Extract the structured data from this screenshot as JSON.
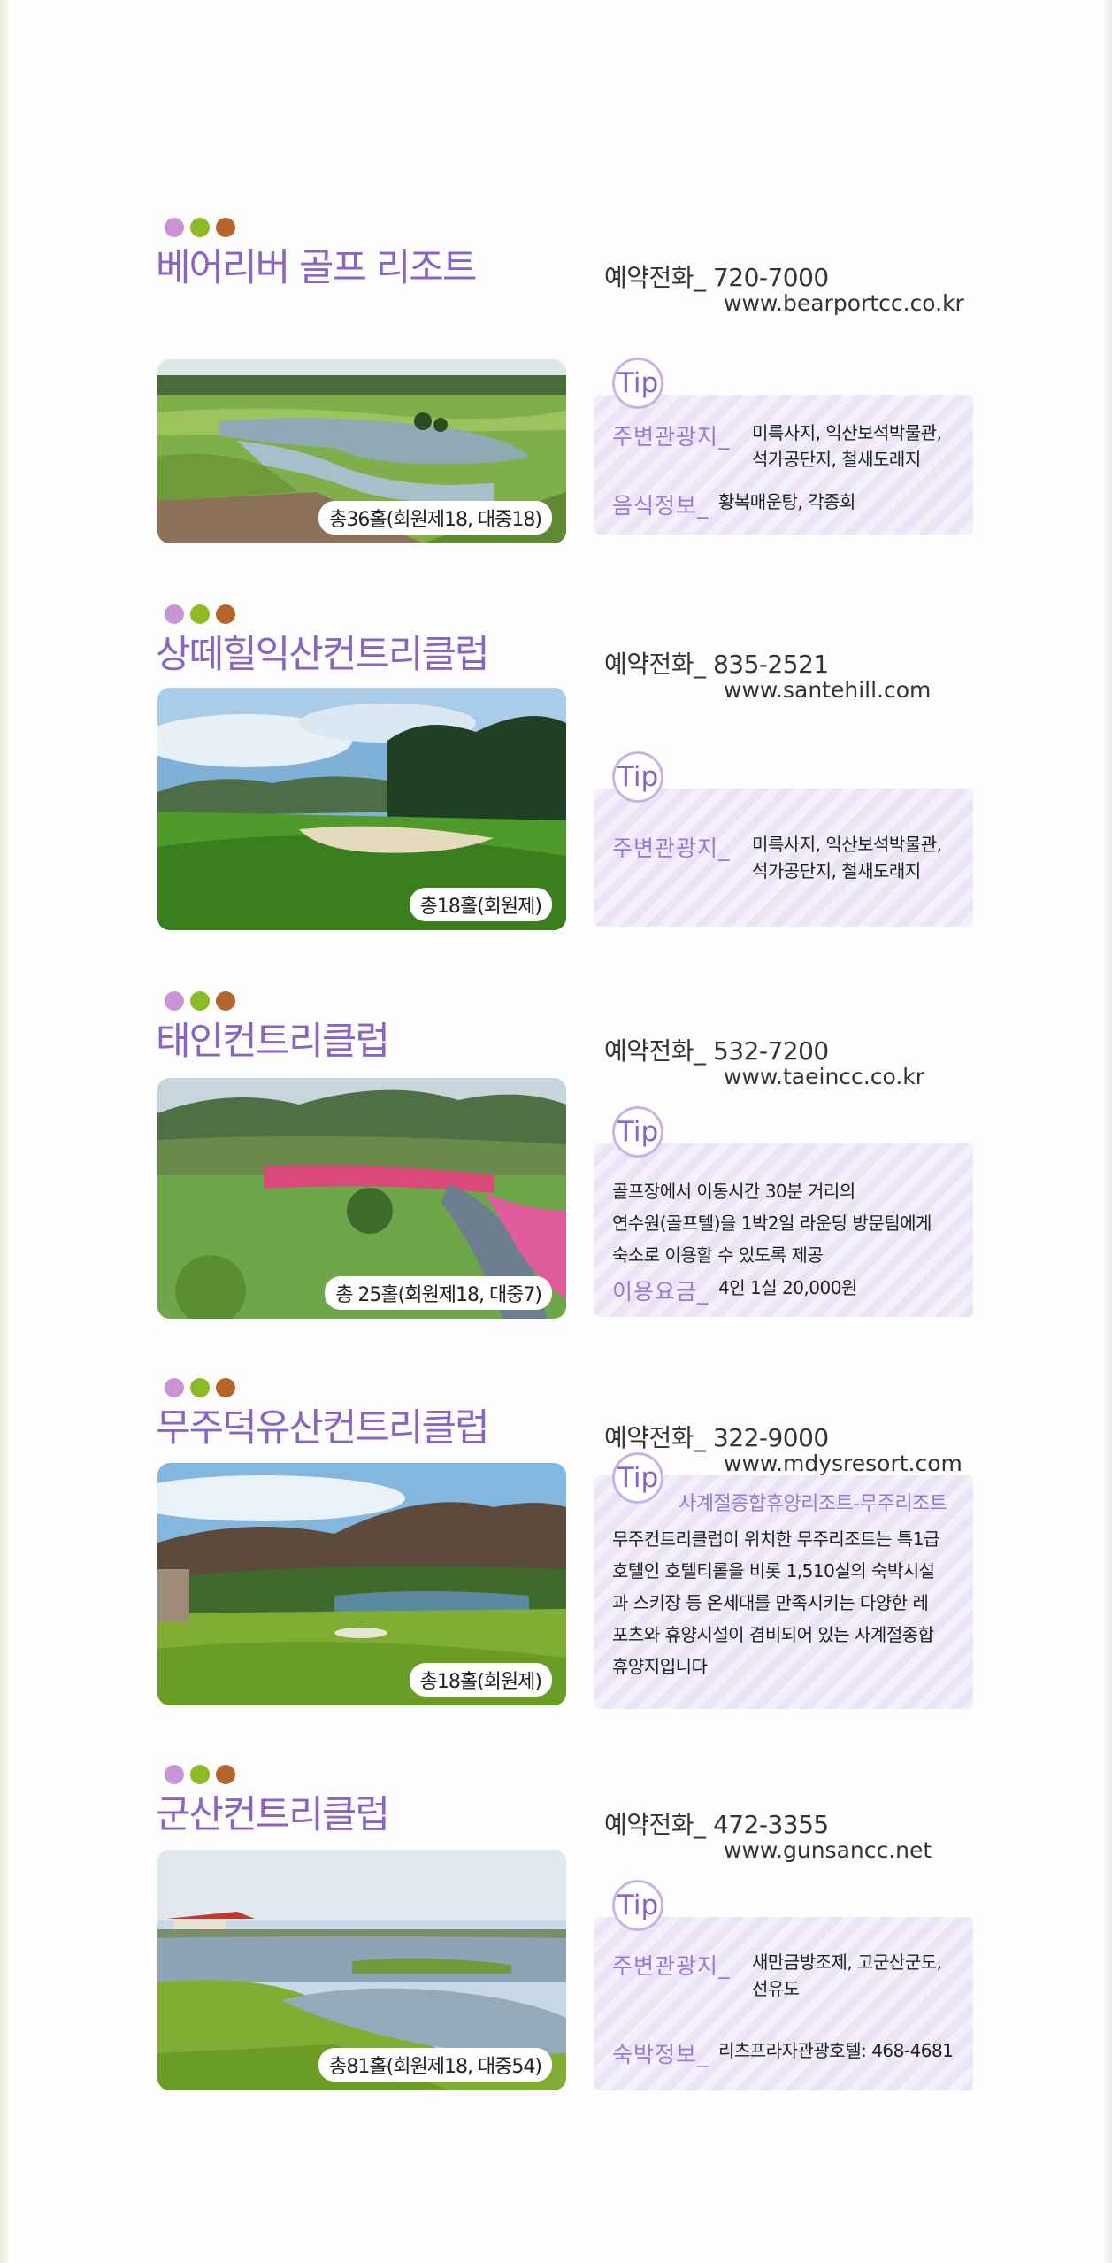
{
  "courses": [
    {
      "title": "베어리버 골프 리조트",
      "phone": "예약전화_ 720-7000",
      "website": "www.bearportcc.co.kr",
      "holes": "총36홀(회원제18, 대중18)",
      "tip_label": "Tip",
      "tip": [
        {
          "label": "주변관광지_",
          "value": "미륵사지, 익산보석박물관,\n석가공단지, 철새도래지"
        },
        {
          "label": "음식정보_",
          "value": "황복매운탕, 각종회"
        }
      ]
    },
    {
      "title": "상떼힐익산컨트리클럽",
      "phone": "예약전화_ 835-2521",
      "website": "www.santehill.com",
      "holes": "총18홀(회원제)",
      "tip_label": "Tip",
      "tip": [
        {
          "label": "주변관광지_",
          "value": "미륵사지, 익산보석박물관,\n석가공단지, 철새도래지"
        }
      ]
    },
    {
      "title": "태인컨트리클럽",
      "phone": "예약전화_ 532-7200",
      "website": "www.taeincc.co.kr",
      "holes": "총 25홀(회원제18, 대중7)",
      "tip_label": "Tip",
      "tip_text": "골프장에서 이동시간 30분 거리의\n연수원(골프텔)을 1박2일 라운딩 방문팀에게\n숙소로 이용할 수 있도록 제공",
      "tip": [
        {
          "label": "이용요금_",
          "value": "4인 1실 20,000원"
        }
      ]
    },
    {
      "title": "무주덕유산컨트리클럽",
      "phone": "예약전화_ 322-9000",
      "website": "www.mdysresort.com",
      "holes": "총18홀(회원제)",
      "tip_label": "Tip",
      "tip_subtitle": "사계절종합휴양리조트-무주리조트",
      "tip_text": "무주컨트리클럽이 위치한 무주리조트는 특1급\n호텔인 호텔티롤을 비롯 1,510실의 숙박시설\n과 스키장 등 온세대를 만족시키는 다양한 레\n포츠와 휴양시설이 겸비되어 있는 사계절종합\n휴양지입니다"
    },
    {
      "title": "군산컨트리클럽",
      "phone": "예약전화_ 472-3355",
      "website": "www.gunsancc.net",
      "holes": "총81홀(회원제18, 대중54)",
      "tip_label": "Tip",
      "tip": [
        {
          "label": "주변관광지_",
          "value": "새만금방조제, 고군산군도,\n선유도"
        },
        {
          "label": "숙박정보_",
          "value": "리츠프라자관광호텔: 468-4681"
        }
      ]
    }
  ],
  "colors": {
    "title": "#8a63c4",
    "dot_pink": "#c994d4",
    "dot_green": "#8dbb26",
    "dot_brown": "#b5642b",
    "tip_label": "#9a7ad0"
  },
  "icons": [
    "three-dot-icon",
    "tip-badge-icon"
  ]
}
